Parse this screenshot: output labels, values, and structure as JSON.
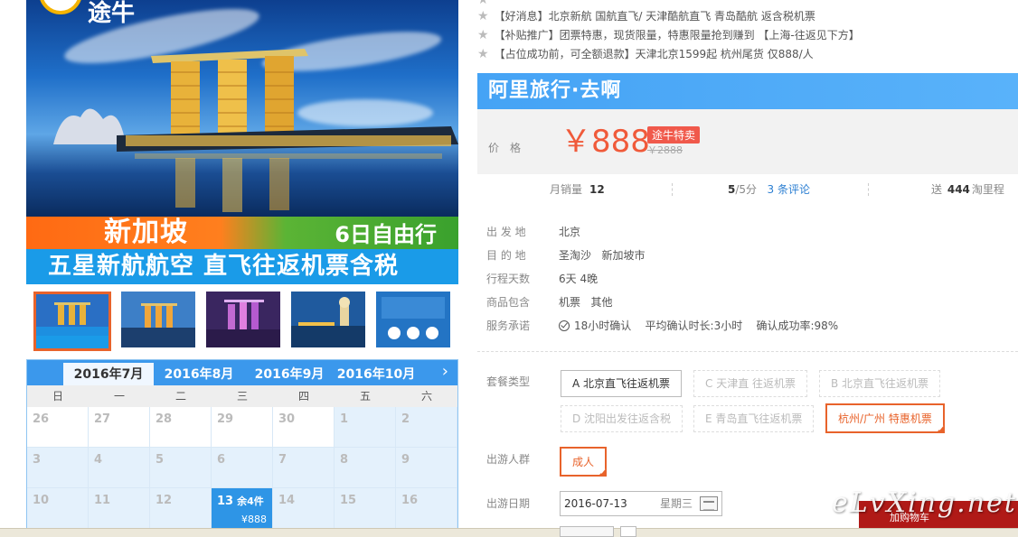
{
  "hero": {
    "logo_text": "途牛",
    "destination": "新加坡",
    "trip_type": "6日自由行",
    "tagline": "五星新航航空 直飞往返机票含税"
  },
  "calendar": {
    "months": [
      "2016年7月",
      "2016年8月",
      "2016年9月",
      "2016年10月"
    ],
    "active_month": "2016年7月",
    "weekdays": [
      "日",
      "一",
      "二",
      "三",
      "四",
      "五",
      "六"
    ],
    "rows": [
      [
        "26",
        "27",
        "28",
        "29",
        "30",
        "1",
        "2"
      ],
      [
        "3",
        "4",
        "5",
        "6",
        "7",
        "8",
        "9"
      ],
      [
        "10",
        "11",
        "12",
        "13",
        "14",
        "15",
        "16"
      ]
    ],
    "selected": {
      "day": "13",
      "remaining": "余4件",
      "price": "¥888"
    }
  },
  "promos": [
    "【好消息】北京新航 国航直飞/ 天津酷航直飞 青岛酷航 返含税机票",
    "【补贴推广】团票特惠，现货限量，特惠限量抢到赚到 【上海-往返见下方】",
    "【占位成功前，可全额退款】天津北京1599起 杭州尾货 仅888/人"
  ],
  "shop": {
    "name": "阿里旅行·去啊"
  },
  "price": {
    "label": "价格",
    "value": "￥888",
    "badge": "途牛特卖",
    "original": "￥2888"
  },
  "stats": {
    "monthly_sales_label": "月销量",
    "monthly_sales": "12",
    "score": "5",
    "score_suffix": "/5分",
    "reviews": "3 条评论",
    "miles_prefix": "送",
    "miles": "444",
    "miles_suffix": "淘里程"
  },
  "info": [
    {
      "key": "出 发 地",
      "value": "北京"
    },
    {
      "key": "目 的 地",
      "value": "圣淘沙   新加坡市"
    },
    {
      "key": "行程天数",
      "value": "6天 4晚"
    },
    {
      "key": "商品包含",
      "value": "机票   其他"
    },
    {
      "key": "服务承诺",
      "value": "18小时确认    平均确认时长:3小时    确认成功率:98%"
    }
  ],
  "options": {
    "package_label": "套餐类型",
    "packages": [
      "A 北京直飞往返机票",
      "C 天津直 往返机票",
      "B 北京直飞往返机票",
      "D 沈阳出发往返含税",
      "E 青岛直飞往返机票",
      "杭州/广州 特惠机票"
    ],
    "group_label": "出游人群",
    "group": "成人",
    "date_label": "出游日期",
    "date": "2016-07-13",
    "weekday": "星期三"
  },
  "watermark": "eLvXing.net",
  "button": {
    "label": "加购物车"
  },
  "colors": {
    "accent": "#3b98ec",
    "price": "#f05a3a",
    "selected": "#e8632b"
  }
}
